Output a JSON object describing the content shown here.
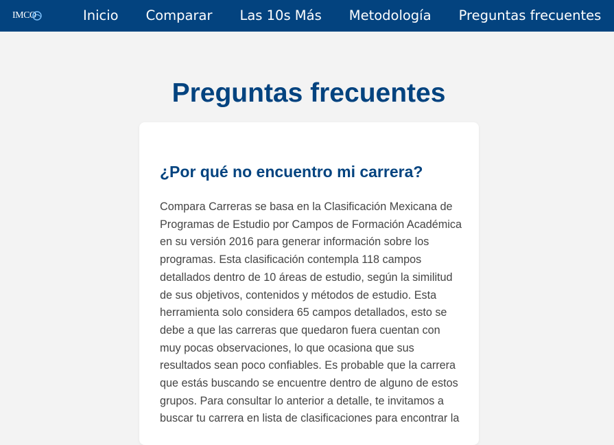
{
  "header": {
    "logo_text": "IMCO",
    "nav": [
      {
        "label": "Inicio"
      },
      {
        "label": "Comparar"
      },
      {
        "label": "Las 10s Más"
      },
      {
        "label": "Metodología"
      },
      {
        "label": "Preguntas frecuentes"
      }
    ]
  },
  "main": {
    "title": "Preguntas frecuentes",
    "faq": {
      "question": "¿Por qué no encuentro mi carrera?",
      "answer": "Compara Carreras se basa en la Clasificación Mexicana de Programas de Estudio por Campos de Formación Académica en su versión 2016 para generar información sobre los programas. Esta clasificación contempla 118 campos detallados dentro de 10 áreas de estudio, según la similitud de sus objetivos, contenidos y métodos de estudio. Esta herramienta solo considera 65 campos detallados, esto se debe a que las carreras que quedaron fuera cuentan con muy pocas observaciones, lo que ocasiona que sus resultados sean poco confiables. Es probable que la carrera que estás buscando se encuentre dentro de alguno de estos grupos. Para consultar lo anterior a detalle, te invitamos a buscar tu carrera en lista de clasificaciones para encontrar la"
    }
  },
  "colors": {
    "brand_blue": "#03437f",
    "page_background": "#f3f3f3",
    "card_background": "#ffffff",
    "body_text": "#444444"
  },
  "icons": {
    "logo": "imco-logo-icon"
  }
}
